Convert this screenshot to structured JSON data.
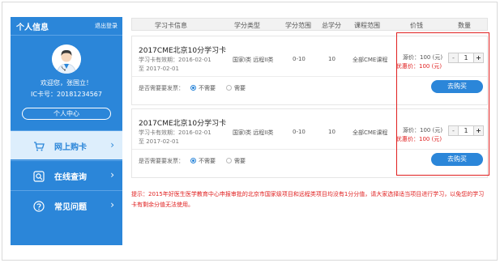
{
  "sidebar": {
    "title": "个人信息",
    "logout": "退出登录",
    "welcome": "欢迎您，张国立！",
    "card_number": "IC卡号：20181234567",
    "center_button": "个人中心",
    "nav": [
      {
        "label": "网上购卡",
        "icon": "cart-icon",
        "active": true
      },
      {
        "label": "在线查询",
        "icon": "search-icon",
        "active": false
      },
      {
        "label": "常见问题",
        "icon": "question-icon",
        "active": false
      }
    ]
  },
  "table": {
    "headers": [
      "学习卡信息",
      "学分类型",
      "学分范围",
      "总学分",
      "课程范围",
      "价钱",
      "数量"
    ]
  },
  "products": [
    {
      "name": "2017CME北京10分学习卡",
      "valid_from": "学习卡有效期：2016-02-01",
      "valid_to": "至 2017-02-01",
      "credit_type": "国家I类 远程II类",
      "credit_range": "0-10",
      "total_credit": "10",
      "course_scope": "全部CME课程",
      "original_price": "源价：100 (元)",
      "sale_price": "优惠价：100 (元)",
      "minus": "-",
      "quantity": "1",
      "plus": "+",
      "invoice_label": "是否需要要发票：",
      "option_no": "不需要",
      "option_yes": "需要",
      "buy": "去购买"
    },
    {
      "name": "2017CME北京10分学习卡",
      "valid_from": "学习卡有效期：2016-02-01",
      "valid_to": "至 2017-02-01",
      "credit_type": "国家I类 远程II类",
      "credit_range": "0-10",
      "total_credit": "10",
      "course_scope": "全部CME课程",
      "original_price": "源价：100 (元)",
      "sale_price": "优惠价：100 (元)",
      "minus": "-",
      "quantity": "1",
      "plus": "+",
      "invoice_label": "是否需要要发票：",
      "option_no": "不需要",
      "option_yes": "需要",
      "buy": "去购买"
    }
  ],
  "notice": "提示：2015年好医生医学教育中心申报审批的北京市国家级项目和远程类项目均没有1分分值，请大家选择适当项目进行学习，以免您的学习卡有剩余分值无法使用。",
  "colors": {
    "primary": "#2b86d9",
    "alert": "#e02020",
    "active_nav_bg": "#ddeefc"
  }
}
